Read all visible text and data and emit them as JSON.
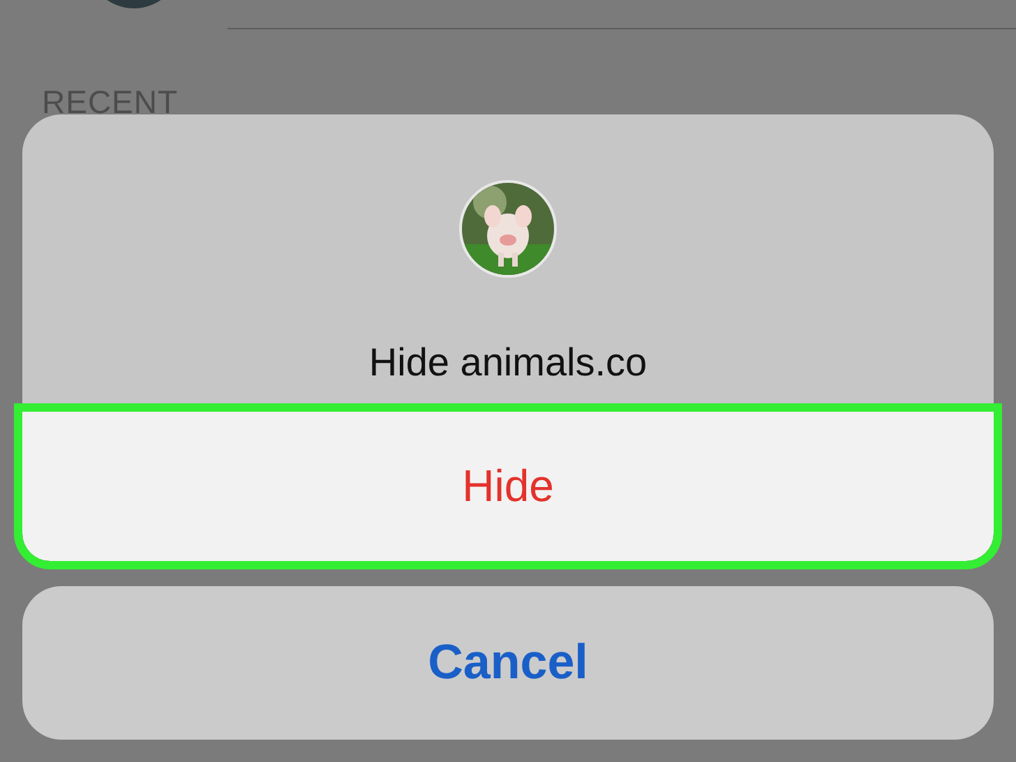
{
  "background": {
    "section_header": "RECENT"
  },
  "action_sheet": {
    "title": "Hide animals.co",
    "actions": [
      {
        "label": "Hide",
        "kind": "destructive",
        "highlighted": true
      }
    ]
  },
  "cancel_button": {
    "label": "Cancel"
  }
}
